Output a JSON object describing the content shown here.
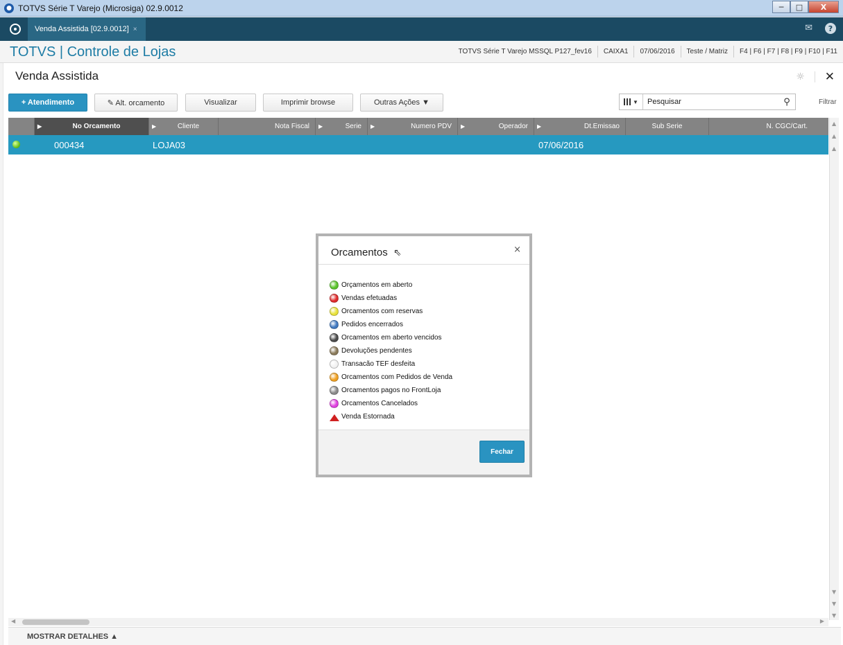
{
  "window": {
    "title": "TOTVS Série T Varejo (Microsiga) 02.9.0012",
    "minimize": "─",
    "maximize": "□",
    "close": "X"
  },
  "tabbar": {
    "tab_label": "Venda Assistida [02.9.0012]",
    "tab_close": "×",
    "mail_icon": "✉",
    "help_icon": "?"
  },
  "appbar": {
    "brand": "TOTVS | Controle de Lojas",
    "environment": "TOTVS Série T Varejo MSSQL P127_fev16",
    "cashier": "CAIXA1",
    "date": "07/06/2016",
    "company": "Teste / Matriz",
    "shortcuts": "F4 | F6 | F7 | F8 | F9 | F10 | F11"
  },
  "page": {
    "title": "Venda Assistida",
    "settings_icon": "☼",
    "close_icon": "✕"
  },
  "toolbar": {
    "atendimento": "+ Atendimento",
    "alt_orcamento": "✎ Alt. orcamento",
    "visualizar": "Visualizar",
    "imprimir": "Imprimir browse",
    "outras": "Outras Ações ▼"
  },
  "search": {
    "columns_caret": "▼",
    "placeholder": "Pesquisar",
    "icon": "🔍",
    "filtrar": "Filtrar"
  },
  "grid": {
    "columns": [
      "No Orcamento",
      "Cliente",
      "Nota Fiscal",
      "Serie",
      "Numero PDV",
      "Operador",
      "Dt.Emissao",
      "Sub Serie",
      "N. CGC/Cart."
    ],
    "row": {
      "numero": "000434",
      "cliente": "LOJA03",
      "emissao": "07/06/2016"
    }
  },
  "details": {
    "label": "MOSTRAR DETALHES ▲"
  },
  "dialog": {
    "title": "Orcamentos",
    "close": "×",
    "button": "Fechar",
    "legend": [
      {
        "label": "Orçamentos em aberto",
        "color": "#5ac42b"
      },
      {
        "label": "Vendas efetuadas",
        "color": "#e02a2a"
      },
      {
        "label": "Orcamentos com reservas",
        "color": "#e8e23a"
      },
      {
        "label": "Pedidos encerrados",
        "color": "#3f78c0"
      },
      {
        "label": "Orcamentos em aberto vencidos",
        "color": "#4a4a4a"
      },
      {
        "label": "Devoluções pendentes",
        "color": "#8a7a5a"
      },
      {
        "label": "Transacão TEF desfeita",
        "color": "#f2f2f2"
      },
      {
        "label": "Orcamentos com Pedidos de Venda",
        "color": "#f0a020"
      },
      {
        "label": "Orcamentos pagos no FrontLoja",
        "color": "#8a8a8a"
      },
      {
        "label": "Orcamentos Cancelados",
        "color": "#e040e0"
      },
      {
        "label": "Venda Estornada",
        "color": "#d02020"
      }
    ]
  }
}
